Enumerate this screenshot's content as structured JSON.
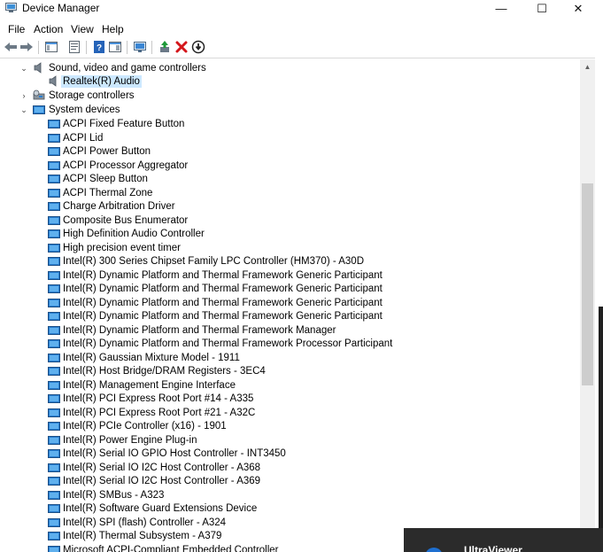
{
  "window": {
    "title": "Device Manager",
    "controls": {
      "minimize": "—",
      "maximize": "☐",
      "close": "✕"
    }
  },
  "menu": [
    "File",
    "Action",
    "View",
    "Help"
  ],
  "toolbar": {
    "buttons": [
      "back-icon",
      "forward-icon",
      "show-hide-console-tree-icon",
      "properties-icon",
      "help-icon",
      "action-pane-icon",
      "scan-hardware-icon",
      "update-driver-icon",
      "uninstall-device-icon",
      "disable-device-icon"
    ]
  },
  "tree": {
    "sound_category": "Sound, video and game controllers",
    "sound_children": [
      "Realtek(R) Audio"
    ],
    "storage_category": "Storage controllers",
    "system_category": "System devices",
    "system_children": [
      "ACPI Fixed Feature Button",
      "ACPI Lid",
      "ACPI Power Button",
      "ACPI Processor Aggregator",
      "ACPI Sleep Button",
      "ACPI Thermal Zone",
      "Charge Arbitration Driver",
      "Composite Bus Enumerator",
      "High Definition Audio Controller",
      "High precision event timer",
      "Intel(R) 300 Series Chipset Family LPC Controller (HM370) - A30D",
      "Intel(R) Dynamic Platform and Thermal Framework Generic Participant",
      "Intel(R) Dynamic Platform and Thermal Framework Generic Participant",
      "Intel(R) Dynamic Platform and Thermal Framework Generic Participant",
      "Intel(R) Dynamic Platform and Thermal Framework Generic Participant",
      "Intel(R) Dynamic Platform and Thermal Framework Manager",
      "Intel(R) Dynamic Platform and Thermal Framework Processor Participant",
      "Intel(R) Gaussian Mixture Model - 1911",
      "Intel(R) Host Bridge/DRAM Registers - 3EC4",
      "Intel(R) Management Engine Interface",
      "Intel(R) PCI Express Root Port #14 - A335",
      "Intel(R) PCI Express Root Port #21 - A32C",
      "Intel(R) PCIe Controller (x16) - 1901",
      "Intel(R) Power Engine Plug-in",
      "Intel(R) Serial IO GPIO Host Controller - INT3450",
      "Intel(R) Serial IO I2C Host Controller - A368",
      "Intel(R) Serial IO I2C Host Controller - A369",
      "Intel(R) SMBus - A323",
      "Intel(R) Software Guard Extensions Device",
      "Intel(R) SPI (flash) Controller - A324",
      "Intel(R) Thermal Subsystem - A379",
      "Microsoft ACPI-Compliant Embedded Controller"
    ]
  },
  "popup": {
    "title": "UltraViewer"
  },
  "colors": {
    "selection": "#cce8ff",
    "scroll_thumb": "#cdcdcd",
    "folder_blue": "#2a7fd0"
  }
}
